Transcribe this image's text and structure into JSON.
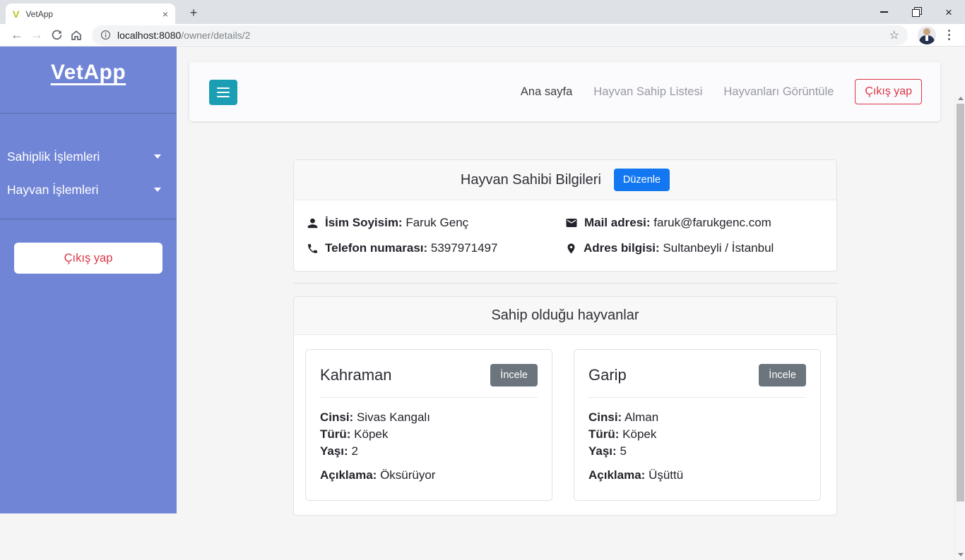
{
  "browser": {
    "tab_title": "VetApp",
    "favicon_letter": "V",
    "url_host": "localhost:8080",
    "url_path": "/owner/details/2",
    "icons": {
      "back": "←",
      "forward": "→",
      "star": "☆",
      "tab_close": "×",
      "new_tab": "+",
      "window_close": "×"
    }
  },
  "sidebar": {
    "title": "VetApp",
    "menu": [
      {
        "label": "Sahiplik İşlemleri"
      },
      {
        "label": "Hayvan İşlemleri"
      }
    ],
    "logout_label": "Çıkış yap"
  },
  "navbar": {
    "links": [
      {
        "label": "Ana sayfa",
        "active": true
      },
      {
        "label": "Hayvan Sahip Listesi",
        "active": false
      },
      {
        "label": "Hayvanları Görüntüle",
        "active": false
      }
    ],
    "logout_label": "Çıkış yap"
  },
  "owner_card": {
    "title": "Hayvan Sahibi Bilgileri",
    "edit_label": "Düzenle",
    "fields": [
      {
        "icon": "user-icon",
        "label": "İsim Soyisim:",
        "value": "Faruk Genç"
      },
      {
        "icon": "phone-icon",
        "label": "Telefon numarası:",
        "value": "5397971497"
      },
      {
        "icon": "mail-icon",
        "label": "Mail adresi:",
        "value": "faruk@farukgenc.com"
      },
      {
        "icon": "map-pin-icon",
        "label": "Adres bilgisi:",
        "value": "Sultanbeyli / İstanbul"
      }
    ]
  },
  "pets_card": {
    "title": "Sahip olduğu hayvanlar",
    "inspect_label": "İncele",
    "labels": {
      "breed": "Cinsi:",
      "type": "Türü:",
      "age": "Yaşı:",
      "desc": "Açıklama:"
    },
    "pets": [
      {
        "name": "Kahraman",
        "breed": "Sivas Kangalı",
        "type": "Köpek",
        "age": "2",
        "desc": "Öksürüyor"
      },
      {
        "name": "Garip",
        "breed": "Alman",
        "type": "Köpek",
        "age": "5",
        "desc": "Üşüttü"
      }
    ]
  },
  "colors": {
    "sidebar_bg": "#7185d6",
    "teal_accent": "#1b9eb4",
    "primary_blue": "#1377f1",
    "secondary_gray": "#6c757d",
    "danger_red": "#dc3545"
  }
}
